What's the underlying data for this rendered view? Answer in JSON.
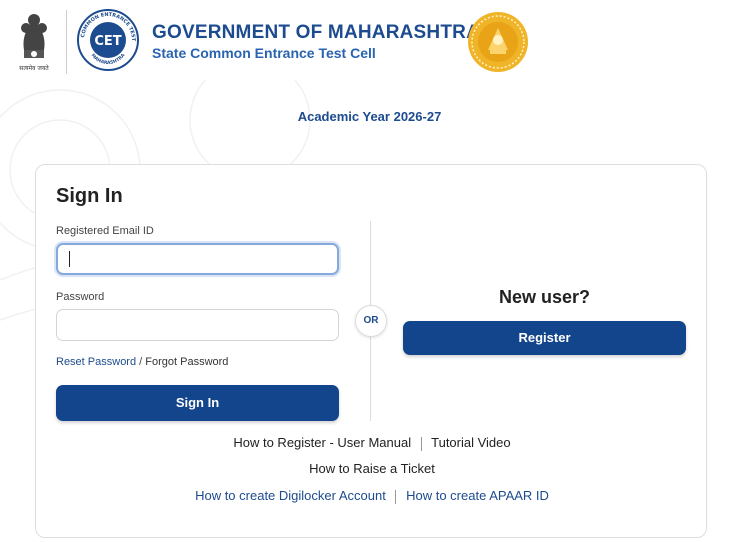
{
  "header": {
    "emblem_motto": "सत्यमेव जयते",
    "cet_logo_ring_text": "STATE COMMON ENTRANCE TEST CELL",
    "cet_logo_initials": "CET",
    "cet_logo_bottom_text": "MAHARASHTRA",
    "title": "GOVERNMENT OF MAHARASHTRA",
    "subtitle": "State Common Entrance Test Cell"
  },
  "academic_year": "Academic Year 2026-27",
  "signin": {
    "title": "Sign In",
    "email_label": "Registered Email ID",
    "email_value": "",
    "password_label": "Password",
    "password_value": "",
    "reset_link": "Reset Password",
    "separator": "/",
    "forgot_link": "Forgot Password",
    "button": "Sign In"
  },
  "or_label": "OR",
  "register": {
    "heading": "New user?",
    "button": "Register"
  },
  "help_links": {
    "how_to_register": "How to Register -",
    "user_manual": "User Manual",
    "tutorial_video": "Tutorial Video",
    "raise_ticket": "How to Raise a Ticket",
    "digilocker": "How to create Digilocker Account",
    "apaar": "How to create APAAR ID"
  },
  "colors": {
    "primary": "#12458b",
    "title_blue": "#1d4b8f",
    "seal_gold": "#e8a317"
  }
}
